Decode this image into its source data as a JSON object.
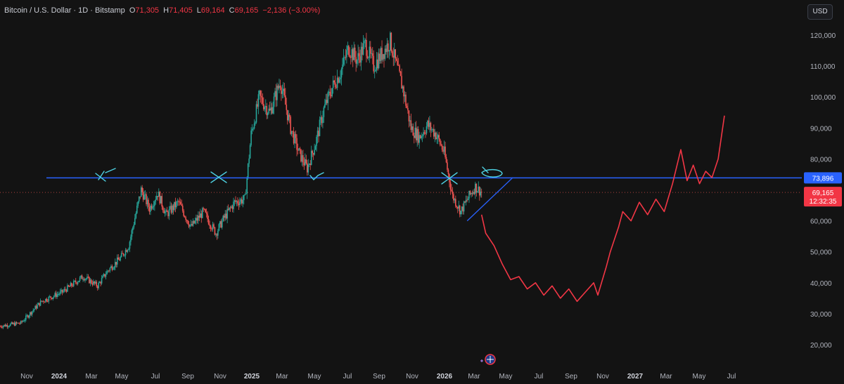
{
  "header": {
    "symbol": "Bitcoin / U.S. Dollar · 1D · Bitstamp",
    "open_label": "O",
    "open": "71,305",
    "high_label": "H",
    "high": "71,405",
    "low_label": "L",
    "low": "69,164",
    "close_label": "C",
    "close": "69,165",
    "change": "−2,136 (−3.00%)"
  },
  "currency_button": "USD",
  "colors": {
    "background": "#131313",
    "up": "#26a69a",
    "down": "#ef5350",
    "resistance_line": "#2962ff",
    "projection": "#f23645",
    "annotation": "#4dd0e1"
  },
  "chart_data": {
    "type": "candlestick",
    "symbol": "BTC/USD",
    "interval": "1D",
    "exchange": "Bitstamp",
    "ylim": [
      15000,
      128000
    ],
    "y_ticks": [
      "20,000",
      "30,000",
      "40,000",
      "50,000",
      "60,000",
      "70,000",
      "80,000",
      "90,000",
      "100,000",
      "110,000",
      "120,000"
    ],
    "x_ticks": [
      "Nov",
      "2024",
      "Mar",
      "May",
      "Jul",
      "Sep",
      "Nov",
      "2025",
      "Mar",
      "May",
      "Jul",
      "Sep",
      "Nov",
      "2026",
      "Mar",
      "May",
      "Jul",
      "Sep",
      "Nov",
      "2027",
      "Mar",
      "May",
      "Jul"
    ],
    "price_path_key_points": [
      [
        0,
        26000
      ],
      [
        10,
        27000
      ],
      [
        20,
        34000
      ],
      [
        30,
        37000
      ],
      [
        40,
        42000
      ],
      [
        47,
        39000
      ],
      [
        52,
        44000
      ],
      [
        58,
        48000
      ],
      [
        62,
        52000
      ],
      [
        68,
        70000
      ],
      [
        72,
        64000
      ],
      [
        76,
        69000
      ],
      [
        80,
        62000
      ],
      [
        86,
        66000
      ],
      [
        92,
        58000
      ],
      [
        98,
        63000
      ],
      [
        104,
        56000
      ],
      [
        108,
        61000
      ],
      [
        113,
        66000
      ],
      [
        118,
        67000
      ],
      [
        121,
        88000
      ],
      [
        125,
        100000
      ],
      [
        130,
        95000
      ],
      [
        135,
        105000
      ],
      [
        140,
        90000
      ],
      [
        144,
        82000
      ],
      [
        148,
        77000
      ],
      [
        152,
        85000
      ],
      [
        156,
        96000
      ],
      [
        160,
        103000
      ],
      [
        164,
        108000
      ],
      [
        168,
        116000
      ],
      [
        172,
        112000
      ],
      [
        176,
        117000
      ],
      [
        180,
        110000
      ],
      [
        184,
        114000
      ],
      [
        188,
        118000
      ],
      [
        191,
        110000
      ],
      [
        194,
        103000
      ],
      [
        198,
        90000
      ],
      [
        202,
        87000
      ],
      [
        206,
        91000
      ],
      [
        210,
        88000
      ],
      [
        214,
        82000
      ],
      [
        218,
        68000
      ],
      [
        222,
        63000
      ],
      [
        226,
        68000
      ],
      [
        229,
        71000
      ],
      [
        232,
        69165
      ]
    ],
    "current_price": "69,165",
    "countdown": "12:32:35",
    "resistance_level": "73,896",
    "resistance_value": 73896,
    "projection_path": [
      [
        232,
        62000
      ],
      [
        234,
        56000
      ],
      [
        238,
        52000
      ],
      [
        242,
        46000
      ],
      [
        246,
        41000
      ],
      [
        250,
        42000
      ],
      [
        254,
        38000
      ],
      [
        258,
        40000
      ],
      [
        262,
        36000
      ],
      [
        266,
        39000
      ],
      [
        270,
        35000
      ],
      [
        274,
        38000
      ],
      [
        278,
        34000
      ],
      [
        282,
        37000
      ],
      [
        286,
        40000
      ],
      [
        288,
        36000
      ],
      [
        292,
        45000
      ],
      [
        294,
        50000
      ],
      [
        298,
        58000
      ],
      [
        300,
        63000
      ],
      [
        304,
        60000
      ],
      [
        308,
        66000
      ],
      [
        312,
        62000
      ],
      [
        316,
        67000
      ],
      [
        320,
        63000
      ],
      [
        324,
        72000
      ],
      [
        328,
        83000
      ],
      [
        331,
        73000
      ],
      [
        334,
        78000
      ],
      [
        337,
        72000
      ],
      [
        340,
        76000
      ],
      [
        343,
        74000
      ],
      [
        346,
        80000
      ],
      [
        349,
        94000
      ]
    ],
    "support_line": [
      [
        221,
        60000
      ],
      [
        243,
        74000
      ]
    ]
  }
}
